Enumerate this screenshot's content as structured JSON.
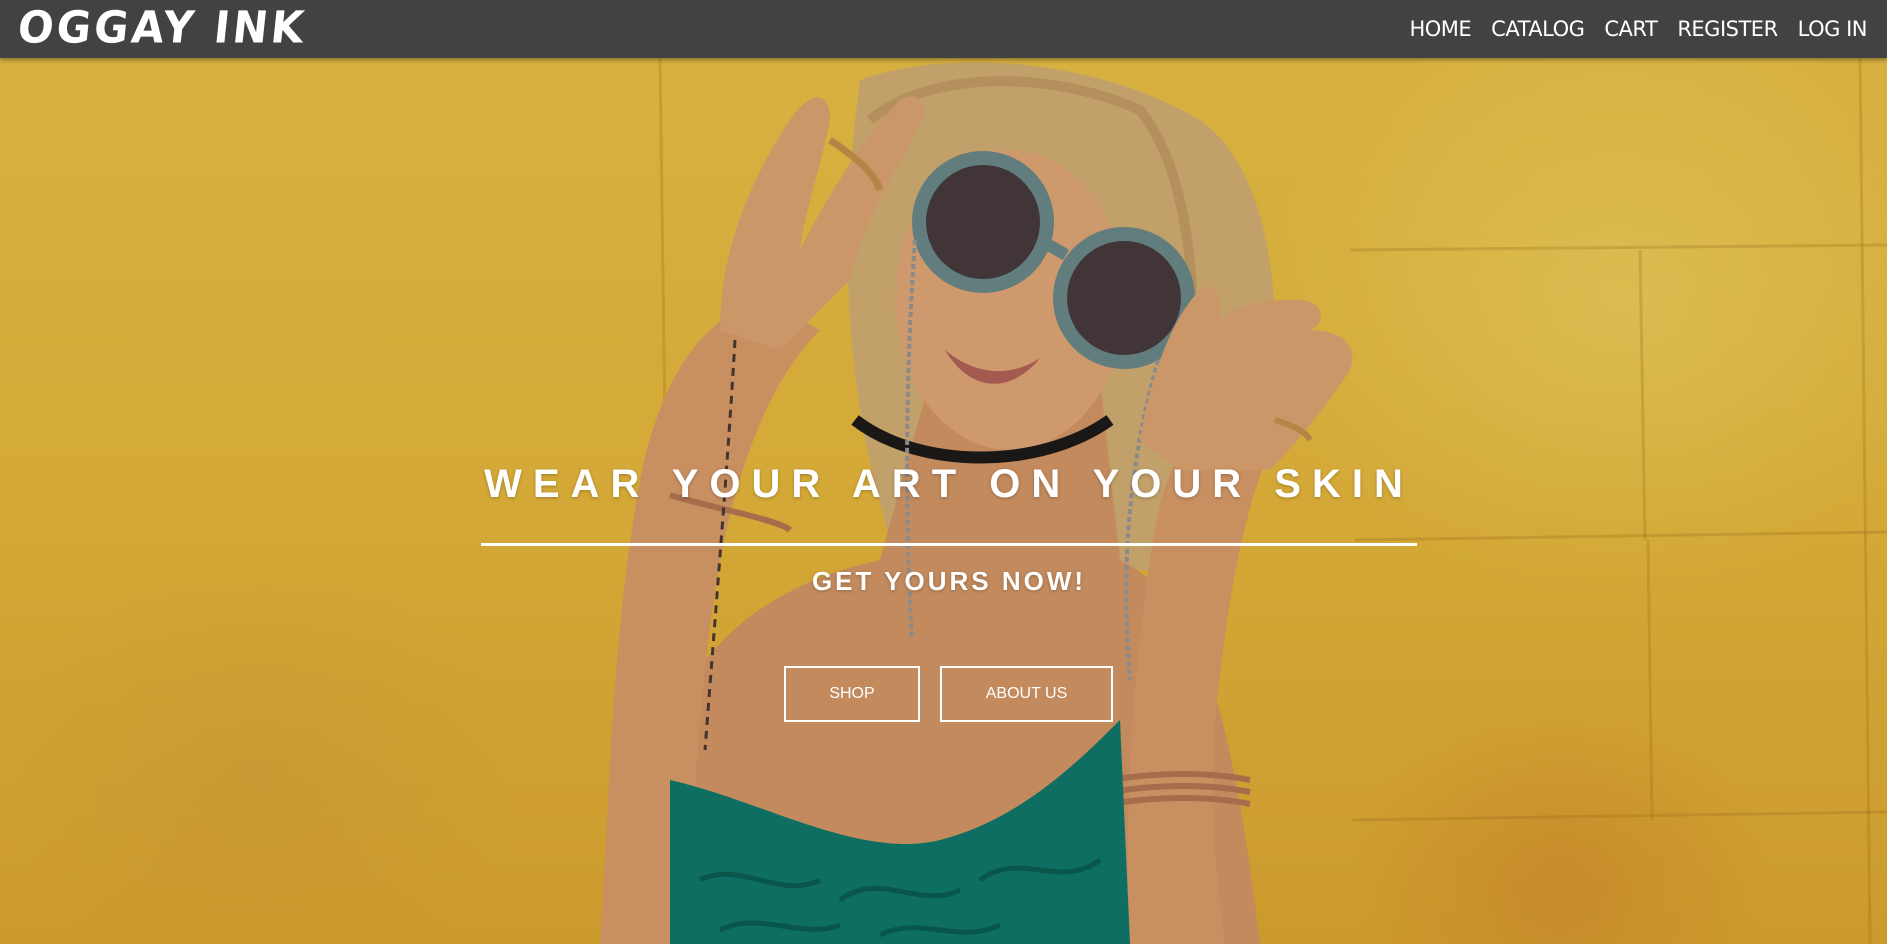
{
  "navbar": {
    "brand": "OGGAY INK",
    "links": [
      "HOME",
      "CATALOG",
      "CART",
      "REGISTER",
      "LOG IN"
    ]
  },
  "hero": {
    "headline": "WEAR YOUR ART ON YOUR SKIN",
    "subheadline": "GET YOURS NOW!",
    "buttons": {
      "shop": "SHOP",
      "about": "ABOUT US"
    }
  },
  "colors": {
    "navbar_bg": "#424242",
    "hero_wall": "#ecbd3e",
    "text": "#ffffff",
    "top_accent": "#1f8a78"
  }
}
